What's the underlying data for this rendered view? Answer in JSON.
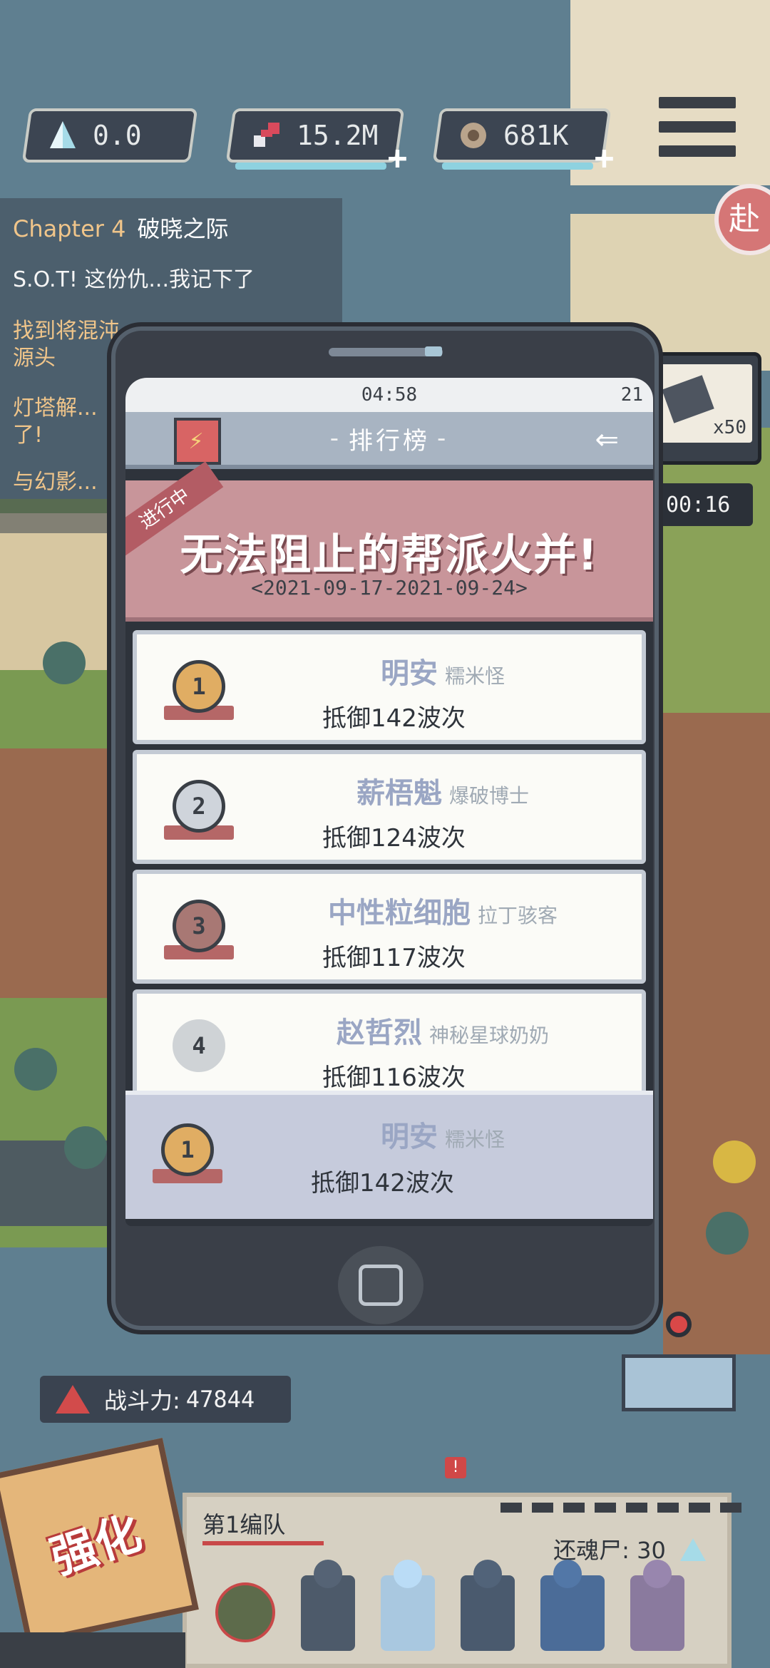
{
  "resources": [
    {
      "icon": "crystal-icon",
      "value": "0.0",
      "has_plus": false
    },
    {
      "icon": "dna-icon",
      "value": "15.2M",
      "has_plus": true
    },
    {
      "icon": "scrap-icon",
      "value": "681K",
      "has_plus": true
    }
  ],
  "quest_panel": {
    "chapter": "Chapter 4",
    "chapter_name": "破晓之际",
    "quests": [
      "S.O.T! 这份仇...我记下了",
      "找到将混沌...\n源头",
      "灯塔解...\n了!",
      "与幻影..."
    ]
  },
  "phone": {
    "status_time": "04:58",
    "status_right": "21",
    "title": "排行榜",
    "event": {
      "tag": "进行中",
      "title": "无法阻止的帮派火并!",
      "date": "<2021-09-17-2021-09-24>"
    },
    "rankings": [
      {
        "rank": "1",
        "name": "明安",
        "title": "糯米怪",
        "score": "抵御142波次"
      },
      {
        "rank": "2",
        "name": "薪梧魁",
        "title": "爆破博士",
        "score": "抵御124波次"
      },
      {
        "rank": "3",
        "name": "中性粒细胞",
        "title": "拉丁骇客",
        "score": "抵御117波次"
      },
      {
        "rank": "4",
        "name": "赵哲烈",
        "title": "神秘星球奶奶",
        "score": "抵御116波次"
      }
    ],
    "my_rank": {
      "rank": "1",
      "name": "明安",
      "title": "糯米怪",
      "score": "抵御142波次"
    }
  },
  "gift_widget": {
    "quantity": "x50",
    "timer": "00:16"
  },
  "edge_button": "赴",
  "combat_power": {
    "label": "战斗力:",
    "value": "47844"
  },
  "squad": {
    "name": "第1编队",
    "souls_label": "还魂尸:",
    "souls_value": "30"
  },
  "upgrade_button": "强化",
  "notification": "!",
  "colors": {
    "accent_red": "#d04848",
    "banner_pink": "#c8959a",
    "name_blue": "#9aa6c4"
  }
}
